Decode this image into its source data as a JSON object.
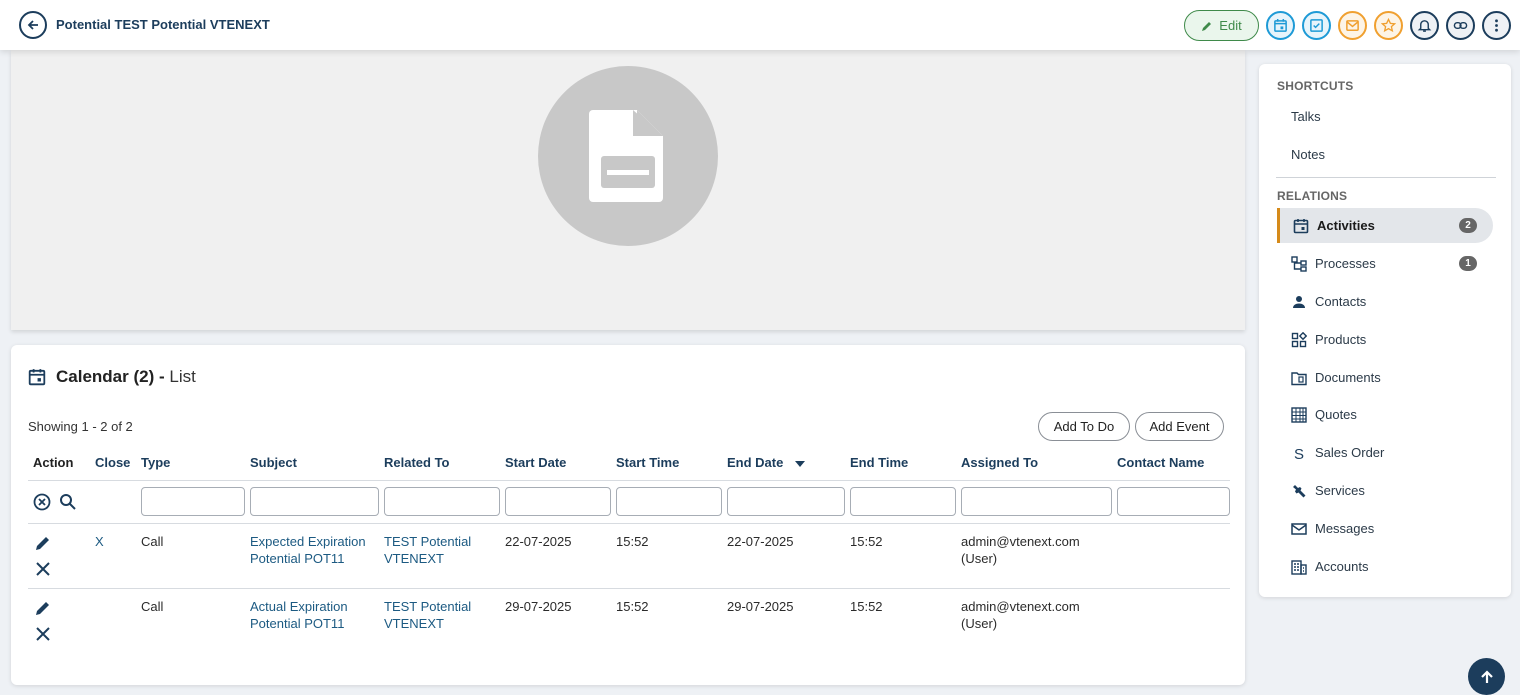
{
  "header": {
    "title": "Potential TEST Potential VTENEXT",
    "edit_label": "Edit",
    "colors": {
      "accent": "#1c3d5c",
      "edit": "#3f8a4a",
      "calendar": "#1e9ad6",
      "todo": "#1e9ad6",
      "mail": "#f0a030",
      "star": "#f0a030"
    }
  },
  "calendar": {
    "title": "Calendar (2) -",
    "view": "List",
    "showing": "Showing 1 - 2 of 2",
    "add_todo": "Add To Do",
    "add_event": "Add Event",
    "columns": [
      "Action",
      "Close",
      "Type",
      "Subject",
      "Related To",
      "Start Date",
      "Start Time",
      "End Date",
      "End Time",
      "Assigned To",
      "Contact Name"
    ],
    "rows": [
      {
        "close": "X",
        "type": "Call",
        "subject": "Expected Expiration Potential POT11",
        "related": "TEST Potential VTENEXT",
        "start_date": "22-07-2025",
        "start_time": "15:52",
        "end_date": "22-07-2025",
        "end_time": "15:52",
        "assigned": "admin@vtenext.com (User)",
        "contact": ""
      },
      {
        "close": "",
        "type": "Call",
        "subject": "Actual Expiration Potential POT11",
        "related": "TEST Potential VTENEXT",
        "start_date": "29-07-2025",
        "start_time": "15:52",
        "end_date": "29-07-2025",
        "end_time": "15:52",
        "assigned": "admin@vtenext.com (User)",
        "contact": ""
      }
    ]
  },
  "sidebar": {
    "shortcuts_title": "SHORTCUTS",
    "shortcuts": [
      "Talks",
      "Notes"
    ],
    "relations_title": "RELATIONS",
    "relations": [
      {
        "label": "Activities",
        "icon": "calendar-icon",
        "count": "2",
        "active": true
      },
      {
        "label": "Processes",
        "icon": "process-icon",
        "count": "1"
      },
      {
        "label": "Contacts",
        "icon": "person-icon"
      },
      {
        "label": "Products",
        "icon": "products-icon"
      },
      {
        "label": "Documents",
        "icon": "folder-icon"
      },
      {
        "label": "Quotes",
        "icon": "grid-icon"
      },
      {
        "label": "Sales Order",
        "icon": "s-icon"
      },
      {
        "label": "Services",
        "icon": "wrench-icon"
      },
      {
        "label": "Messages",
        "icon": "mail-icon"
      },
      {
        "label": "Accounts",
        "icon": "building-icon"
      }
    ]
  }
}
